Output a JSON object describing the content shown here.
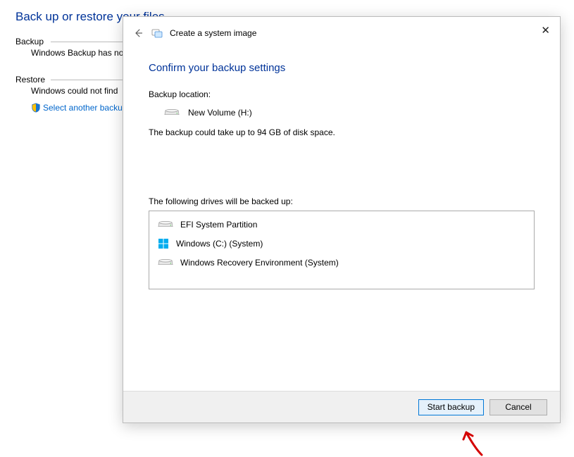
{
  "bg": {
    "title": "Back up or restore your files",
    "backup": {
      "heading": "Backup",
      "status": "Windows Backup has no"
    },
    "restore": {
      "heading": "Restore",
      "status": "Windows could not find",
      "link": "Select another backu"
    }
  },
  "dialog": {
    "wizard_title": "Create a system image",
    "heading": "Confirm your backup settings",
    "location_label": "Backup location:",
    "location_value": "New Volume (H:)",
    "space_text": "The backup could take up to 94 GB of disk space.",
    "drives_label": "The following drives will be backed up:",
    "drives": [
      {
        "name": "EFI System Partition",
        "icon": "drive"
      },
      {
        "name": "Windows (C:) (System)",
        "icon": "winlogo"
      },
      {
        "name": "Windows Recovery Environment (System)",
        "icon": "drive"
      }
    ],
    "buttons": {
      "start": "Start backup",
      "cancel": "Cancel"
    }
  }
}
